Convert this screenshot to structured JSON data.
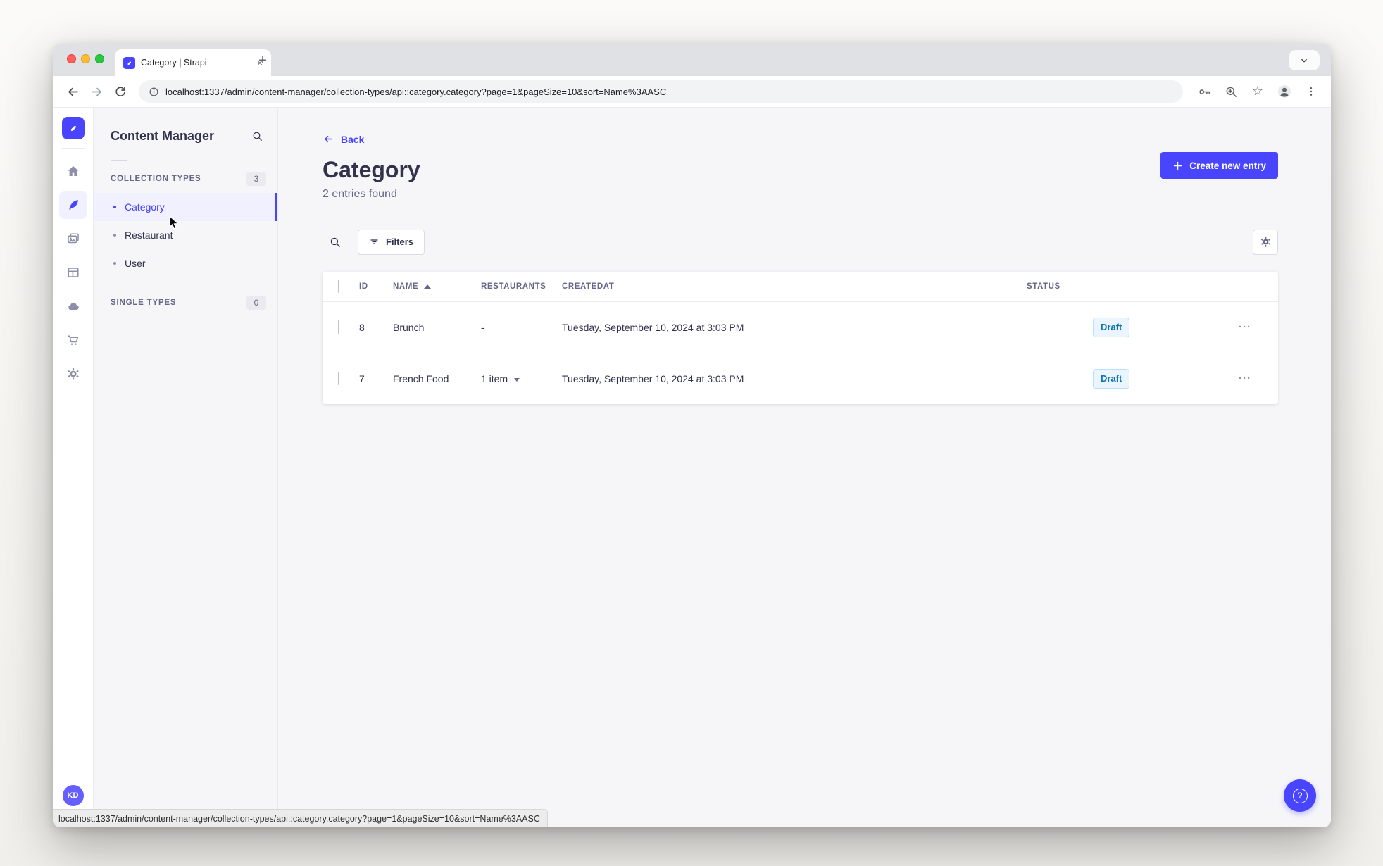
{
  "browser": {
    "tab_title": "Category | Strapi",
    "close_glyph": "×",
    "new_tab_glyph": "+",
    "url": "localhost:1337/admin/content-manager/collection-types/api::category.category?page=1&pageSize=10&sort=Name%3AASC",
    "bookmark_glyph": "☆"
  },
  "nav_rail": {
    "icons": [
      "home",
      "content-manager",
      "media-library",
      "content-type-builder",
      "cloud",
      "marketplace",
      "settings"
    ],
    "avatar_initials": "KD"
  },
  "subnav": {
    "title": "Content Manager",
    "collection_types": {
      "label": "COLLECTION TYPES",
      "count": "3",
      "items": [
        {
          "label": "Category",
          "active": true
        },
        {
          "label": "Restaurant",
          "active": false
        },
        {
          "label": "User",
          "active": false
        }
      ]
    },
    "single_types": {
      "label": "SINGLE TYPES",
      "count": "0"
    }
  },
  "main": {
    "back_label": "Back",
    "title": "Category",
    "subtitle": "2 entries found",
    "create_button_label": "Create new entry",
    "filters_button_label": "Filters"
  },
  "table": {
    "headers": {
      "id": "ID",
      "name": "NAME",
      "restaurants": "RESTAURANTS",
      "createdat": "CREATEDAT",
      "status": "STATUS"
    },
    "rows": [
      {
        "id": "8",
        "name": "Brunch",
        "restaurants": "-",
        "createdat": "Tuesday, September 10, 2024 at 3:03 PM",
        "status": "Draft",
        "actions": "···"
      },
      {
        "id": "7",
        "name": "French Food",
        "restaurants": "1 item",
        "createdat": "Tuesday, September 10, 2024 at 3:03 PM",
        "status": "Draft",
        "actions": "···"
      }
    ]
  },
  "help": {
    "glyph": "?"
  },
  "colors": {
    "accent": "#4945ff",
    "active_item_bg": "#f0f0ff",
    "draft_bg": "#eaf5ff",
    "draft_border": "#b8e1ff",
    "draft_text": "#0c75af",
    "text_dark": "#32324d",
    "text_muted": "#666687"
  }
}
